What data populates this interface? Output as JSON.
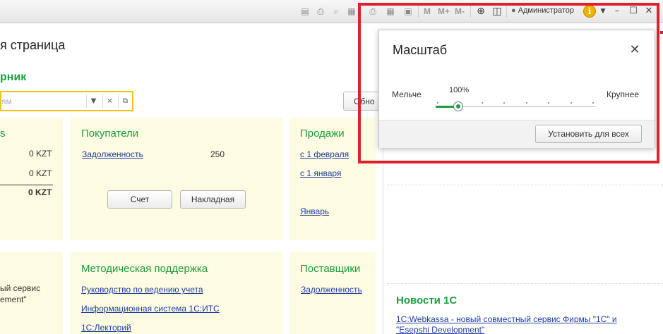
{
  "toolbar": {
    "user_name": "Администратор",
    "zoom_m": "M",
    "zoom_m_plus": "M+",
    "zoom_m_minus": "M-",
    "info_label": "i"
  },
  "page": {
    "title": "я страница",
    "section_title": "рник",
    "search": {
      "placeholder": "ям"
    },
    "refresh_button": "Обно"
  },
  "panels": {
    "left": {
      "rows": [
        {
          "value": "0 KZT"
        },
        {
          "value": "0 KZT"
        },
        {
          "value": "0 KZT"
        }
      ],
      "lower_text_line1": "ый сервис",
      "lower_text_line2": "ement\""
    },
    "buyers": {
      "title": "Покупатели",
      "debt_link": "Задолженность",
      "debt_value": "250",
      "invoice_button": "Счет",
      "waybill_button": "Накладная"
    },
    "sales": {
      "title": "Продажи",
      "links": [
        "с 1 февраля",
        "с 1 января",
        "Январь"
      ]
    },
    "support": {
      "title": "Методическая поддержка",
      "links": [
        "Руководство по ведению учета",
        "Информационная система 1С:ИТС",
        "1С:Лекторий"
      ]
    },
    "suppliers": {
      "title": "Поставщики",
      "debt_link": "Задолженность"
    }
  },
  "news": {
    "title": "Новости 1С",
    "link": "1С:Webkassa - новый совместный сервис Фирмы \"1С\" и \"Esepshi Development\""
  },
  "zoom_dialog": {
    "title": "Масштаб",
    "smaller_label": "Мельче",
    "larger_label": "Крупнее",
    "value_label": "100%",
    "slider_fraction": 0.14,
    "set_all_button": "Установить для всех"
  },
  "colors": {
    "accent_green": "#1b9e3e",
    "link_blue": "#1f3f9f",
    "panel_bg": "#fdfbe2",
    "highlight_red": "#e0202a",
    "search_border": "#f0c419"
  }
}
